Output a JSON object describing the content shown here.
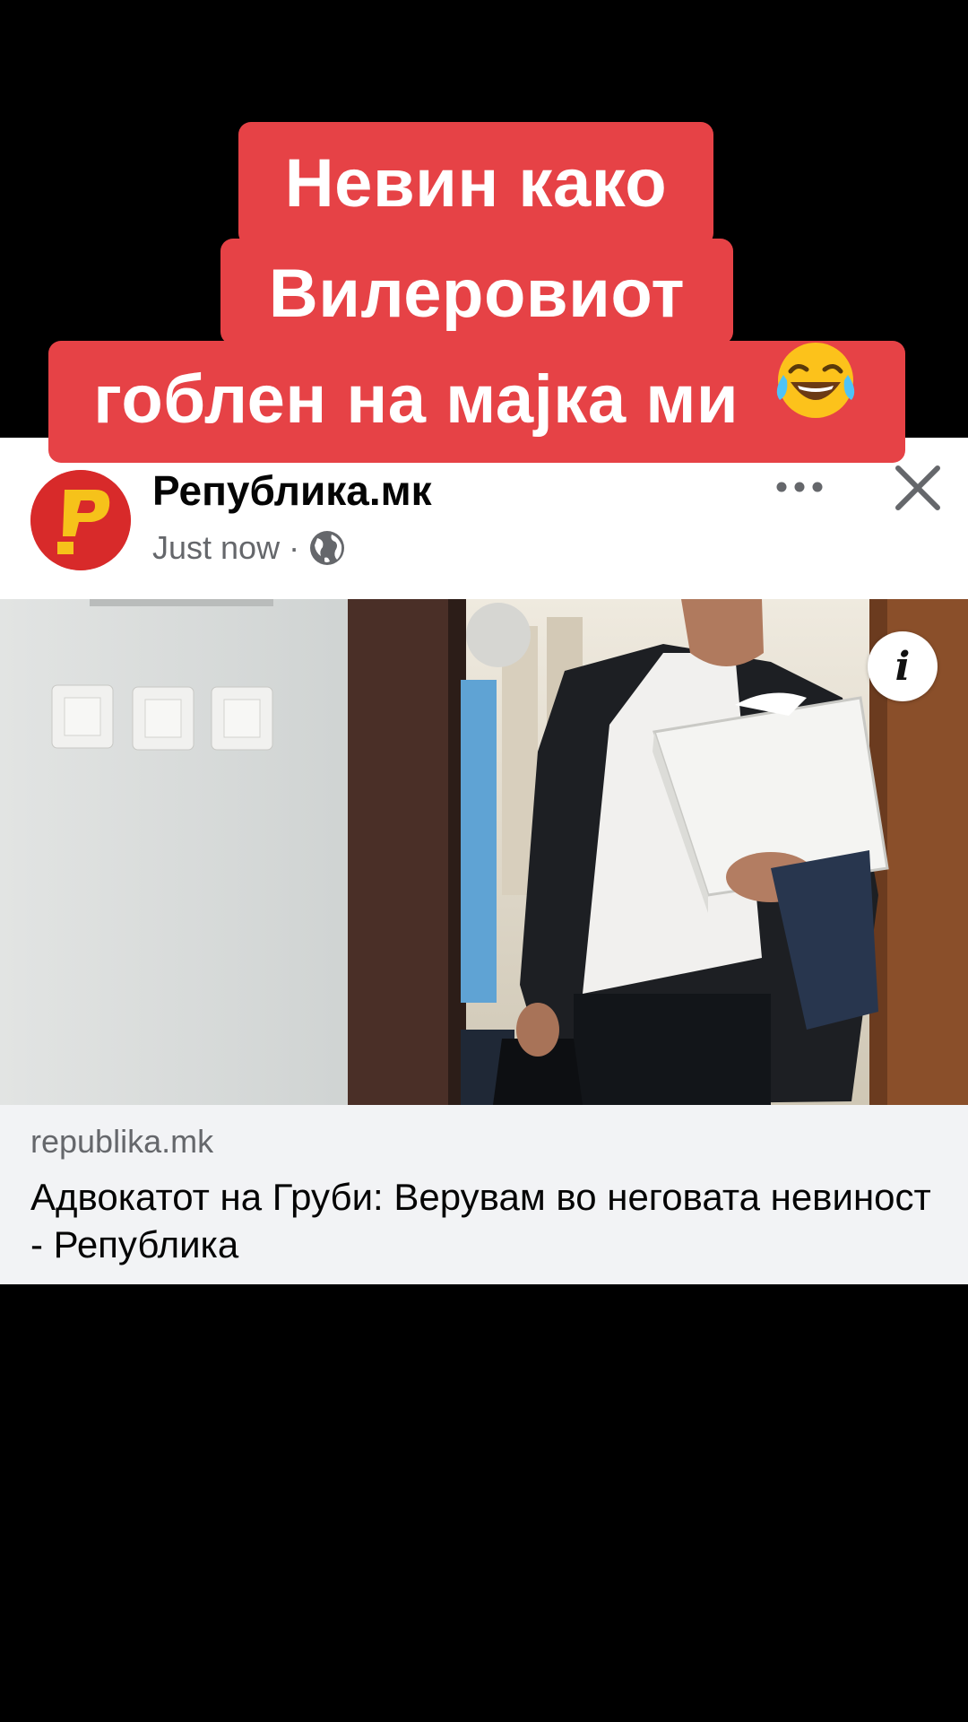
{
  "caption": {
    "line1": "Невин како",
    "line2": "Вилеровиот",
    "line3": "гоблен на мајка ми",
    "emoji": "face-with-tears-of-joy"
  },
  "post": {
    "page_name": "Република.мк",
    "timestamp": "Just now",
    "separator": "·",
    "privacy_icon": "globe-icon",
    "more_icon": "more-horizontal-icon",
    "close_icon": "close-icon",
    "info_icon": "info-icon",
    "info_label": "i"
  },
  "link": {
    "domain": "republika.mk",
    "title": "Адвокатот на Груби: Верувам во неговата невиност - Република"
  },
  "colors": {
    "caption_bg": "#e64246",
    "avatar_bg": "#d82a2a",
    "avatar_mark": "#f6c21a",
    "preview_bg": "#f2f3f5",
    "meta_text": "#65676b"
  }
}
